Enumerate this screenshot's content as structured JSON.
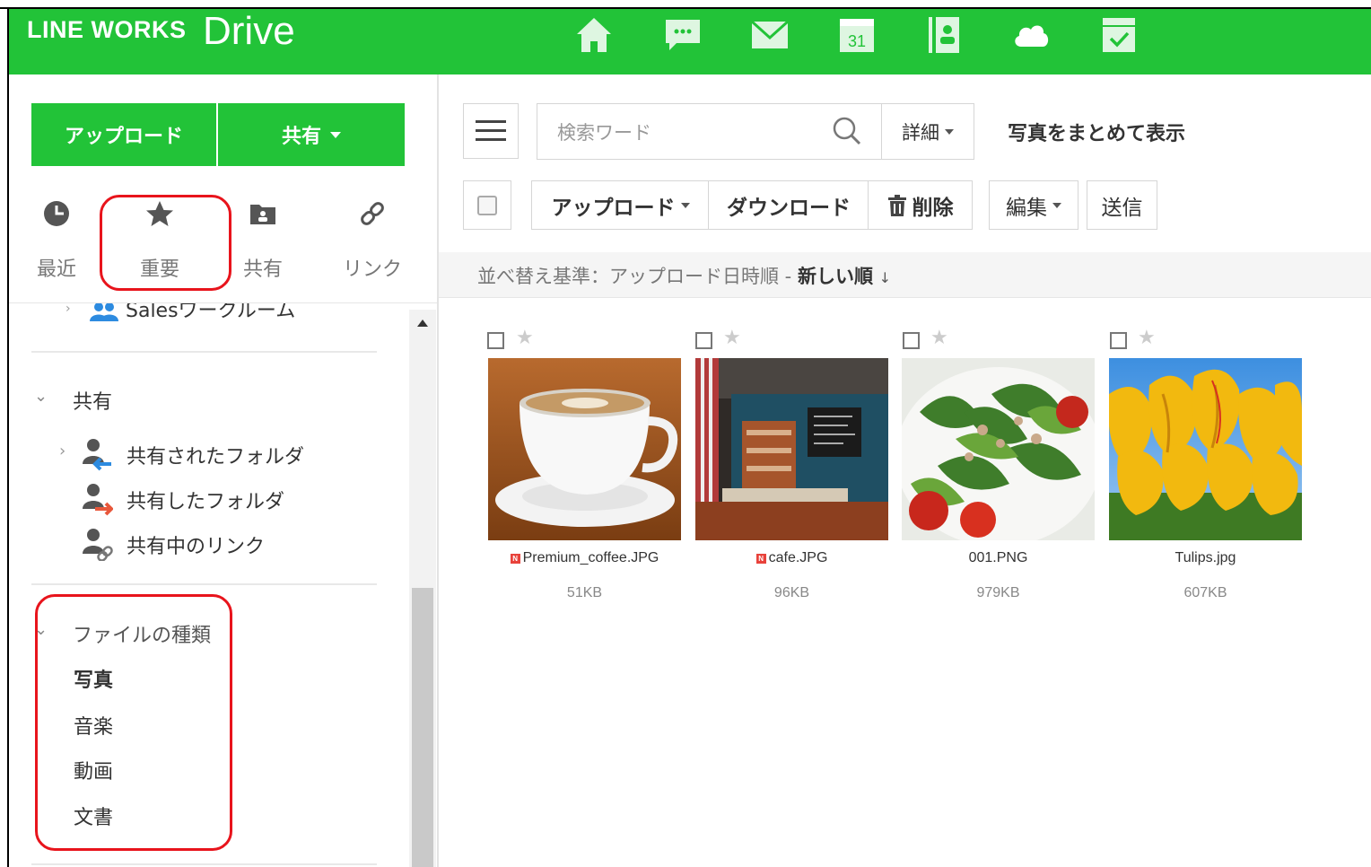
{
  "header": {
    "brand": "LINE WORKS",
    "product": "Drive",
    "calendar_day": "31",
    "accent_color": "#22c338",
    "apps": [
      "home-icon",
      "chat-icon",
      "mail-icon",
      "calendar-icon",
      "contacts-icon",
      "drive-cloud-icon",
      "tasks-icon"
    ]
  },
  "sidebar": {
    "upload_label": "アップロード",
    "share_label": "共有",
    "quick": [
      {
        "label": "最近",
        "icon": "clock-icon"
      },
      {
        "label": "重要",
        "icon": "star-icon"
      },
      {
        "label": "共有",
        "icon": "shared-folder-icon"
      },
      {
        "label": "リンク",
        "icon": "link-icon"
      }
    ],
    "partial_room": "Salesワークルーム",
    "shared_section": "共有",
    "shared_items": [
      "共有されたフォルダ",
      "共有したフォルダ",
      "共有中のリンク"
    ],
    "file_type_section": "ファイルの種類",
    "file_types": [
      "写真",
      "音楽",
      "動画",
      "文書"
    ]
  },
  "toolbar": {
    "search_placeholder": "検索ワード",
    "detail_label": "詳細",
    "photo_view_label": "写真をまとめて表示",
    "upload_label": "アップロード",
    "download_label": "ダウンロード",
    "delete_label": "削除",
    "edit_label": "編集",
    "send_label": "送信"
  },
  "sort": {
    "prefix": "並べ替え基準：アップロード日時順 -",
    "order": "新しい順",
    "arrow": "↓"
  },
  "files": [
    {
      "name": "Premium_coffee.JPG",
      "size": "51KB",
      "new": true,
      "badge": "N"
    },
    {
      "name": "cafe.JPG",
      "size": "96KB",
      "new": true,
      "badge": "N"
    },
    {
      "name": "001.PNG",
      "size": "979KB",
      "new": false
    },
    {
      "name": "Tulips.jpg",
      "size": "607KB",
      "new": false
    }
  ]
}
